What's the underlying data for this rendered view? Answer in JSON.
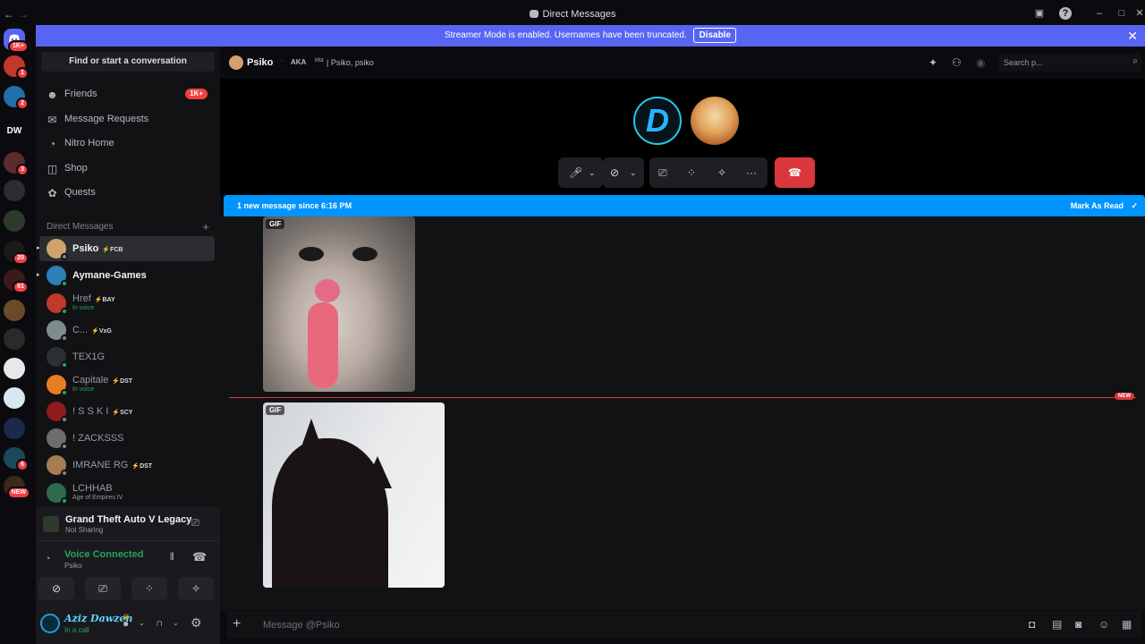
{
  "window": {
    "title": "Direct Messages"
  },
  "banner": {
    "text": "Streamer Mode is enabled. Usernames have been truncated.",
    "button": "Disable"
  },
  "guilds": {
    "dm_badge": "1K+",
    "items": [
      {
        "label": "",
        "badge": "1"
      },
      {
        "label": "",
        "badge": "2"
      },
      {
        "label": "DW",
        "badge": ""
      },
      {
        "label": "",
        "badge": "3"
      },
      {
        "label": "",
        "badge": ""
      },
      {
        "label": "",
        "badge": ""
      },
      {
        "label": "",
        "badge": "20"
      },
      {
        "label": "",
        "badge": "61"
      },
      {
        "label": "",
        "badge": ""
      },
      {
        "label": "",
        "badge": ""
      },
      {
        "label": "",
        "badge": ""
      },
      {
        "label": "",
        "badge": ""
      },
      {
        "label": "",
        "badge": ""
      },
      {
        "label": "",
        "badge": "6"
      },
      {
        "label": "",
        "badge": "NEW"
      }
    ]
  },
  "sidebar": {
    "search": "Find or start a conversation",
    "nav": [
      {
        "label": "Friends",
        "badge": "1K+"
      },
      {
        "label": "Message Requests",
        "badge": ""
      },
      {
        "label": "Nitro Home",
        "badge": ""
      },
      {
        "label": "Shop",
        "badge": ""
      },
      {
        "label": "Quests",
        "badge": ""
      }
    ],
    "dm_header": "Direct Messages",
    "dms": [
      {
        "name": "Psiko",
        "tag": "FCB",
        "sub": "",
        "status": "#80848e",
        "color": "#d1a26a"
      },
      {
        "name": "Aymane-Games",
        "tag": "",
        "sub": "",
        "status": "#23a55a",
        "color": "#2c7fb8"
      },
      {
        "name": "Href",
        "tag": "BAY",
        "sub": "In voice",
        "status": "#23a55a",
        "color": "#c0392b"
      },
      {
        "name": "C...",
        "tag": "VxG",
        "sub": "",
        "status": "#80848e",
        "color": "#7f8c8d"
      },
      {
        "name": "TEX1G",
        "tag": "",
        "sub": "",
        "status": "#23a55a",
        "color": "#2d2f33"
      },
      {
        "name": "Capitale",
        "tag": "DST",
        "sub": "In voice",
        "status": "#23a55a",
        "color": "#e67e22"
      },
      {
        "name": "! S S K I",
        "tag": "SCY",
        "sub": "",
        "status": "#80848e",
        "color": "#8e1b1b"
      },
      {
        "name": "! ZACKSSS",
        "tag": "",
        "sub": "",
        "status": "#80848e",
        "color": "#6d6d6d"
      },
      {
        "name": "IMRANE RG",
        "tag": "DST",
        "sub": "",
        "status": "#80848e",
        "color": "#a67c52"
      },
      {
        "name": "LCHHAB",
        "tag": "",
        "sub": "Age of Empires IV",
        "status": "#23a55a",
        "color": "#2e6b4f"
      }
    ]
  },
  "activity": {
    "title": "Grand Theft Auto V Legacy",
    "sub": "Not Sharing"
  },
  "voice": {
    "title": "Voice Connected",
    "sub": "Psiko"
  },
  "user": {
    "name": "Aziz Dawzen",
    "status": "In a call"
  },
  "chat": {
    "recipient": "Psiko",
    "aka_label": "AKA",
    "aka_prefix": "Mst",
    "aka_names": "| Psiko, psiko",
    "search_placeholder": "Search p..."
  },
  "new_messages": {
    "text": "1 new message since 6:16 PM",
    "mark_read": "Mark As Read"
  },
  "divider": {
    "label": "NEW"
  },
  "gifs": [
    {
      "tag": "GIF"
    },
    {
      "tag": "GIF"
    }
  ],
  "composer": {
    "placeholder": "Message @Psiko"
  },
  "colors": {
    "accent": "#5865f2",
    "danger": "#da373c",
    "new_bar": "#0094ff",
    "online": "#23a55a"
  }
}
